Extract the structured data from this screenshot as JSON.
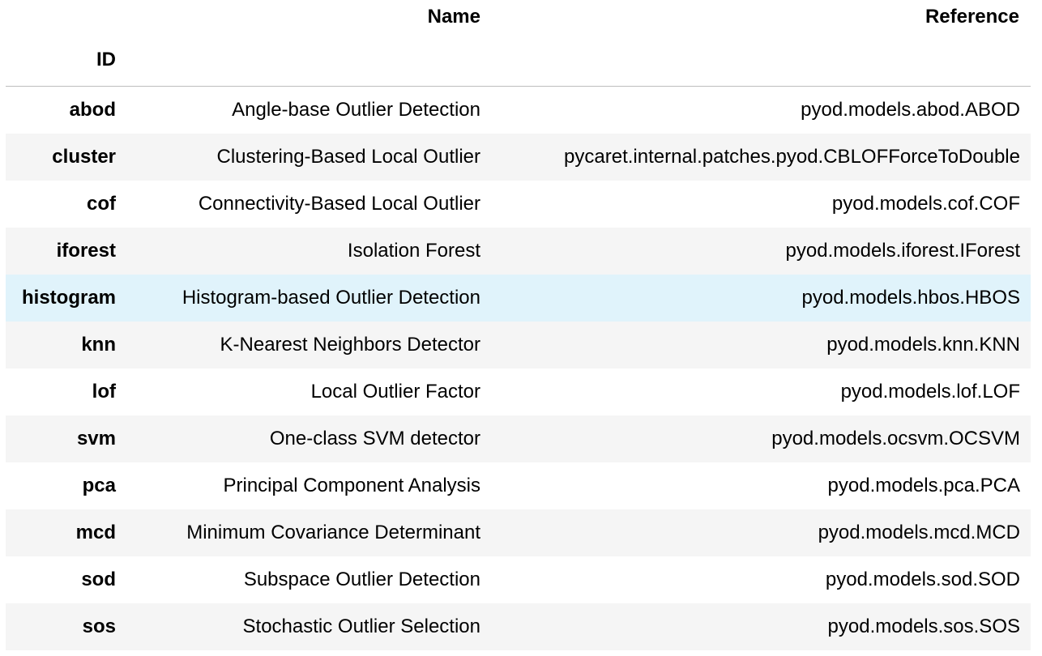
{
  "table": {
    "columns": [
      "Name",
      "Reference"
    ],
    "index_name": "ID",
    "highlight_row": "histogram",
    "highlight_color": "#e0f3fb",
    "stripe_color": "#f5f5f5",
    "rows": [
      {
        "id": "abod",
        "name": "Angle-base Outlier Detection",
        "reference": "pyod.models.abod.ABOD"
      },
      {
        "id": "cluster",
        "name": "Clustering-Based Local Outlier",
        "reference": "pycaret.internal.patches.pyod.CBLOFForceToDouble"
      },
      {
        "id": "cof",
        "name": "Connectivity-Based Local Outlier",
        "reference": "pyod.models.cof.COF"
      },
      {
        "id": "iforest",
        "name": "Isolation Forest",
        "reference": "pyod.models.iforest.IForest"
      },
      {
        "id": "histogram",
        "name": "Histogram-based Outlier Detection",
        "reference": "pyod.models.hbos.HBOS"
      },
      {
        "id": "knn",
        "name": "K-Nearest Neighbors Detector",
        "reference": "pyod.models.knn.KNN"
      },
      {
        "id": "lof",
        "name": "Local Outlier Factor",
        "reference": "pyod.models.lof.LOF"
      },
      {
        "id": "svm",
        "name": "One-class SVM detector",
        "reference": "pyod.models.ocsvm.OCSVM"
      },
      {
        "id": "pca",
        "name": "Principal Component Analysis",
        "reference": "pyod.models.pca.PCA"
      },
      {
        "id": "mcd",
        "name": "Minimum Covariance Determinant",
        "reference": "pyod.models.mcd.MCD"
      },
      {
        "id": "sod",
        "name": "Subspace Outlier Detection",
        "reference": "pyod.models.sod.SOD"
      },
      {
        "id": "sos",
        "name": "Stochastic Outlier Selection",
        "reference": "pyod.models.sos.SOS"
      }
    ]
  }
}
